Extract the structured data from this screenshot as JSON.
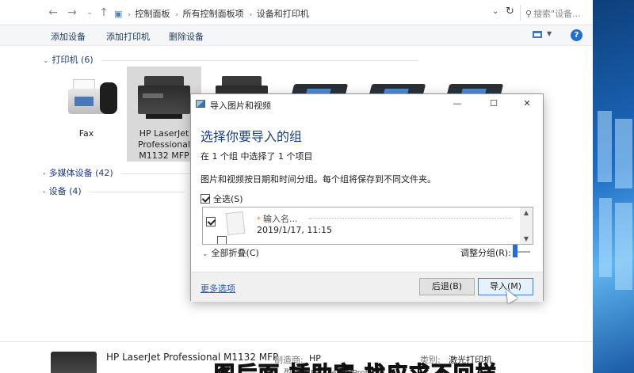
{
  "address_bar": {
    "breadcrumbs": [
      "控制面板",
      "所有控制面板项",
      "设备和打印机"
    ],
    "search_placeholder": "搜索\"设备..."
  },
  "toolbar": {
    "add_device": "添加设备",
    "add_printer": "添加打印机",
    "remove_device": "删除设备"
  },
  "groups": {
    "printers": "打印机 (6)",
    "multimedia": "多媒体设备 (42)",
    "devices": "设备 (4)"
  },
  "devices": [
    {
      "label": "Fax"
    },
    {
      "label_lines": [
        "HP LaserJet",
        "Professional",
        "M1132 MFP"
      ]
    }
  ],
  "dialog": {
    "title": "导入图片和视频",
    "heading": "选择你要导入的组",
    "status": "在 1 个组 中选择了 1 个项目",
    "description": "图片和视频按日期和时间分组。每个组将保存到不同文件夹。",
    "select_all": "全选(S)",
    "group": {
      "name_placeholder": "输入名...",
      "date": "2019/1/17, 11:15"
    },
    "collapse_all": "全部折叠(C)",
    "adjust_groups": "调整分组(R):",
    "more_options": "更多选项",
    "back": "后退(B)",
    "import": "导入(M)"
  },
  "statusbar": {
    "device_name": "HP LaserJet Professional M1132 MFP",
    "manufacturer_label": "制造商:",
    "manufacturer_value": "HP",
    "category_label": "类别:",
    "category_value": "激光打印机",
    "model_line": "型号: HP LaserJet Professi..."
  },
  "subtitle": "图后面 插助宾 找应求不回样"
}
